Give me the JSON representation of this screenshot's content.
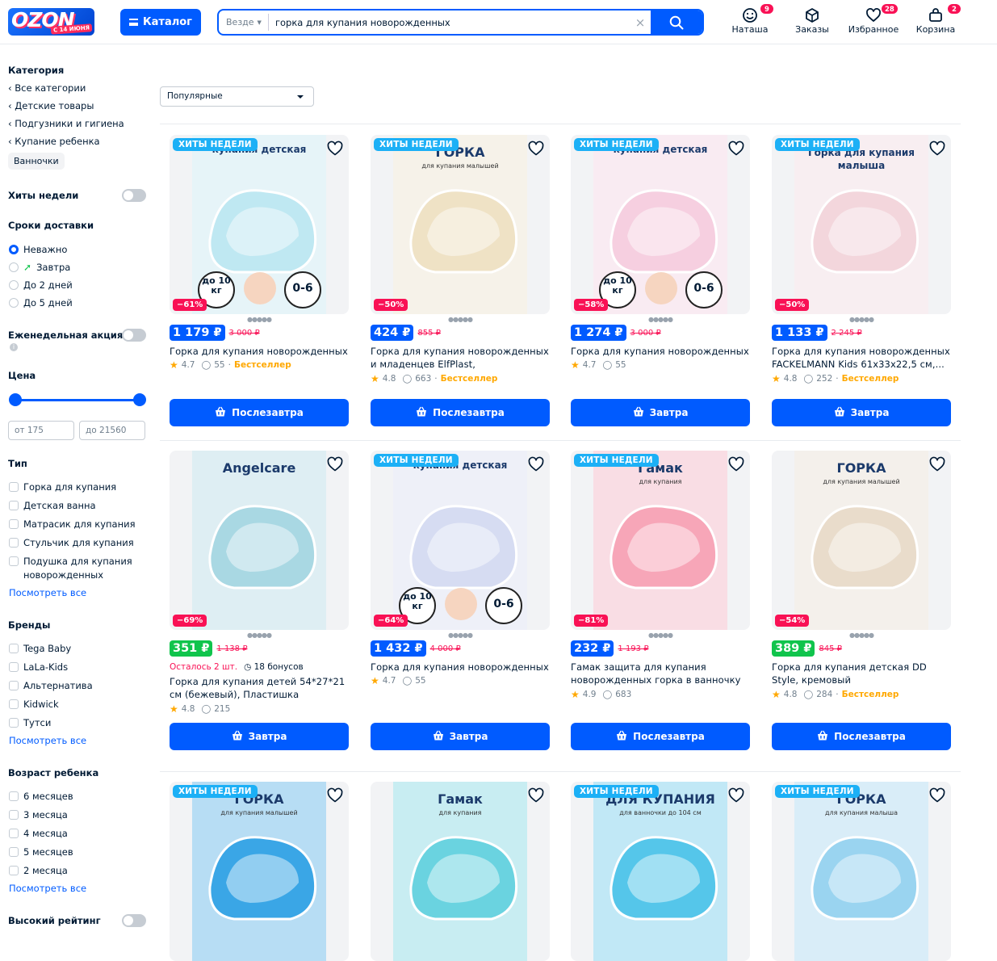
{
  "header": {
    "logo_text": "OZON",
    "logo_sub": "С 14 ИЮНЯ",
    "catalog_label": "Каталог",
    "search_scope": "Везде",
    "search_value": "горка для купания новорожденных",
    "icons": [
      {
        "label": "Наташа",
        "badge": "9",
        "icon": "smile-icon"
      },
      {
        "label": "Заказы",
        "badge": "",
        "icon": "box-icon"
      },
      {
        "label": "Избранное",
        "badge": "28",
        "icon": "heart-icon"
      },
      {
        "label": "Корзина",
        "badge": "2",
        "icon": "bag-icon"
      }
    ]
  },
  "sidebar": {
    "category_title": "Категория",
    "categories": [
      "Все категории",
      "Детские товары",
      "Подгузники и гигиена",
      "Купание ребенка"
    ],
    "current_category": "Ванночки",
    "hits_label": "Хиты недели",
    "delivery_title": "Сроки доставки",
    "delivery_options": [
      "Неважно",
      "Завтра",
      "До 2 дней",
      "До 5 дней"
    ],
    "weekly_label": "Еженедельная акция",
    "price_title": "Цена",
    "price_from": "от 175",
    "price_to": "до 21560",
    "type_title": "Тип",
    "types": [
      "Горка для купания",
      "Детская ванна",
      "Матрасик для купания",
      "Стульчик для купания",
      "Подушка для купания новорожденных"
    ],
    "see_all": "Посмотреть все",
    "brands_title": "Бренды",
    "brands": [
      "Tega Baby",
      "LaLa-Kids",
      "Альтернатива",
      "Kidwick",
      "Тутси"
    ],
    "age_title": "Возраст ребенка",
    "ages": [
      "6 месяцев",
      "3 месяца",
      "4 месяца",
      "5 месяцев",
      "2 месяца"
    ],
    "rating_label": "Высокий рейтинг"
  },
  "sort": {
    "selected": "Популярные"
  },
  "products": [
    {
      "badge": "ХИТЫ НЕДЕЛИ",
      "discount": "−61%",
      "price": "1 179 ₽",
      "old": "3 000 ₽",
      "title": "Горка для купания новорожденных",
      "rating": "4.7",
      "reviews": "55",
      "tag": "Бестселлер",
      "button": "Послезавтра",
      "green": false,
      "img_text": "купания детская",
      "weight": "до 10 кг",
      "age": "0-6",
      "color": "#bfe8f2"
    },
    {
      "badge": "ХИТЫ НЕДЕЛИ",
      "discount": "−50%",
      "price": "424 ₽",
      "old": "855 ₽",
      "title": "Горка для купания новорожденных и младенцев ElfPlast, пластиковая,...",
      "rating": "4.8",
      "reviews": "663",
      "tag": "Бестселлер",
      "button": "Послезавтра",
      "green": false,
      "img_text": "ГОРКА",
      "img_sub": "для купания малышей",
      "color": "#efe2c5"
    },
    {
      "badge": "ХИТЫ НЕДЕЛИ",
      "discount": "−58%",
      "price": "1 274 ₽",
      "old": "3 000 ₽",
      "title": "Горка для купания новорожденных",
      "rating": "4.7",
      "reviews": "55",
      "tag": "",
      "button": "Завтра",
      "green": false,
      "img_text": "купания детская",
      "weight": "до 10 кг",
      "age": "0-6",
      "color": "#f6cfe0"
    },
    {
      "badge": "ХИТЫ НЕДЕЛИ",
      "discount": "−50%",
      "price": "1 133 ₽",
      "old": "2 245 ₽",
      "title": "Горка для купания новорожденных FACKELMANN Kids 61x33x22,5 см,...",
      "rating": "4.8",
      "reviews": "252",
      "tag": "Бестселлер",
      "button": "Завтра",
      "green": false,
      "img_text": "Горка для купания малыша",
      "color": "#f3d6dc"
    },
    {
      "badge": "",
      "discount": "−69%",
      "price": "351 ₽",
      "old": "1 138 ₽",
      "title": "Горка для купания детей 54*27*21 см (бежевый), Пластишка",
      "rating": "4.8",
      "reviews": "215",
      "tag": "",
      "button": "Завтра",
      "green": true,
      "left": "Осталось 2 шт.",
      "bonus": "18 бонусов",
      "img_text": "Angelcare",
      "color": "#a9d8e3"
    },
    {
      "badge": "ХИТЫ НЕДЕЛИ",
      "discount": "−64%",
      "price": "1 432 ₽",
      "old": "4 000 ₽",
      "title": "Горка для купания новорожденных",
      "rating": "4.7",
      "reviews": "55",
      "tag": "",
      "button": "Завтра",
      "green": false,
      "img_text": "купания детская",
      "weight": "до 10 кг",
      "age": "0-6",
      "color": "#d6dcf2"
    },
    {
      "badge": "ХИТЫ НЕДЕЛИ",
      "discount": "−81%",
      "price": "232 ₽",
      "old": "1 193 ₽",
      "title": "Гамак защита для купания новорожденных горка в ванночку",
      "rating": "4.9",
      "reviews": "683",
      "tag": "",
      "button": "Послезавтра",
      "green": false,
      "img_text": "Гамак",
      "img_sub": "для купания",
      "color": "#f7a6b8"
    },
    {
      "badge": "",
      "discount": "−54%",
      "price": "389 ₽",
      "old": "845 ₽",
      "title": "Горка для купания детская DD Style, кремовый",
      "rating": "4.8",
      "reviews": "284",
      "tag": "Бестселлер",
      "button": "Послезавтра",
      "green": true,
      "img_text": "ГОРКА",
      "img_sub": "для купания малышей",
      "color": "#e9dccb"
    },
    {
      "badge": "ХИТЫ НЕДЕЛИ",
      "img_text": "ГОРКА",
      "img_sub": "для купания малышей",
      "color": "#3aa6e6"
    },
    {
      "badge": "",
      "img_text": "Гамак",
      "img_sub": "для купания",
      "color": "#6ad3e0"
    },
    {
      "badge": "ХИТЫ НЕДЕЛИ",
      "img_text": "ДЛЯ КУПАНИЯ",
      "img_sub": "для ванночки до 104 см",
      "color": "#55c6ea"
    },
    {
      "badge": "ХИТЫ НЕДЕЛИ",
      "img_text": "ГОРКА",
      "img_sub": "для купания малыша",
      "color": "#9ad4f0"
    }
  ]
}
